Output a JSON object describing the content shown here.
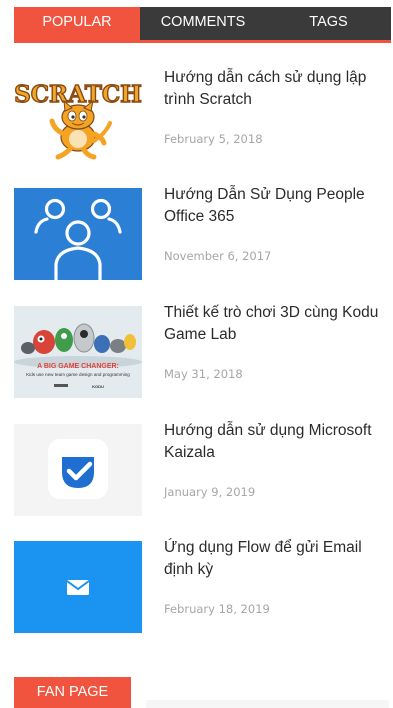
{
  "tabs": {
    "popular": "POPULAR",
    "comments": "COMMENTS",
    "tags": "TAGS"
  },
  "posts": [
    {
      "title": "Hướng dẫn cách sử dụng lập trình Scratch",
      "date": "February 5, 2018",
      "thumb_text": "SCRATCH"
    },
    {
      "title": "Hướng Dẫn Sử Dụng People Office 365",
      "date": "November 6, 2017"
    },
    {
      "title": "Thiết kế trò chơi 3D cùng Kodu Game Lab",
      "date": "May 31, 2018",
      "thumb_heading": "A BIG GAME CHANGER:",
      "thumb_caption": "Kids use new team game design and programming",
      "thumb_logo": "KODU"
    },
    {
      "title": "Hướng dẫn sử dụng Microsoft Kaizala",
      "date": "January 9, 2019"
    },
    {
      "title": "Ứng dụng Flow để gửi Email định kỳ",
      "date": "February 18, 2019"
    }
  ],
  "fan_page": {
    "label": "FAN PAGE"
  },
  "colors": {
    "accent": "#f0533e",
    "tab_bar": "#3a3a3a",
    "people_blue": "#2b7fd4",
    "kaizala_blue": "#1e6fd0",
    "flow_blue": "#1b93f0"
  }
}
